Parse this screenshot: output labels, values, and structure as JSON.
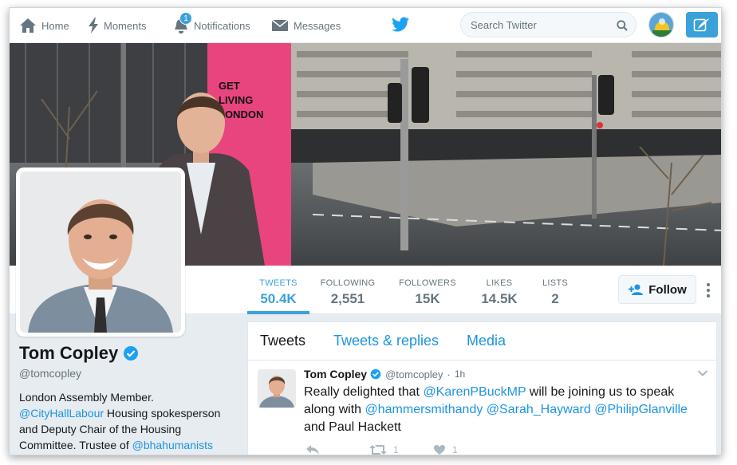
{
  "nav": {
    "home": "Home",
    "moments": "Moments",
    "notifications": "Notifications",
    "notifications_count": "1",
    "messages": "Messages"
  },
  "search": {
    "placeholder": "Search Twitter"
  },
  "colors": {
    "accent": "#3aa1d9",
    "link": "#1b95e0",
    "text": "#14171a",
    "muted": "#66757f"
  },
  "stats": [
    {
      "label": "TWEETS",
      "value": "50.4K",
      "active": true
    },
    {
      "label": "FOLLOWING",
      "value": "2,551"
    },
    {
      "label": "FOLLOWERS",
      "value": "15K"
    },
    {
      "label": "LIKES",
      "value": "14.5K"
    },
    {
      "label": "LISTS",
      "value": "2"
    }
  ],
  "follow_label": "Follow",
  "profile": {
    "name": "Tom Copley",
    "handle": "@tomcopley",
    "bio_line1": "London Assembly Member.",
    "bio_link1": "@CityHallLabour",
    "bio_line2": " Housing spokesperson",
    "bio_line3": "and Deputy Chair of the Housing",
    "bio_line4": "Committee. Trustee of ",
    "bio_link2": "@bhahumanists"
  },
  "header_sign": {
    "line1": "GET",
    "line2": "LIVING",
    "line3": "LONDON"
  },
  "tabs": [
    {
      "label": "Tweets",
      "active": true
    },
    {
      "label": "Tweets & replies"
    },
    {
      "label": "Media"
    }
  ],
  "tweet": {
    "name": "Tom Copley",
    "handle": "@tomcopley",
    "dot": "·",
    "time": "1h",
    "text_1": "Really delighted that ",
    "mention_1": "@KarenPBuckMP",
    "text_2": " will be joining us to speak along with ",
    "mention_2": "@hammersmithandy",
    "text_3": " ",
    "mention_3": "@Sarah_Hayward",
    "text_4": " ",
    "mention_4": "@PhilipGlanville",
    "text_5": " and Paul Hackett",
    "retweets": "1",
    "likes": "1"
  }
}
